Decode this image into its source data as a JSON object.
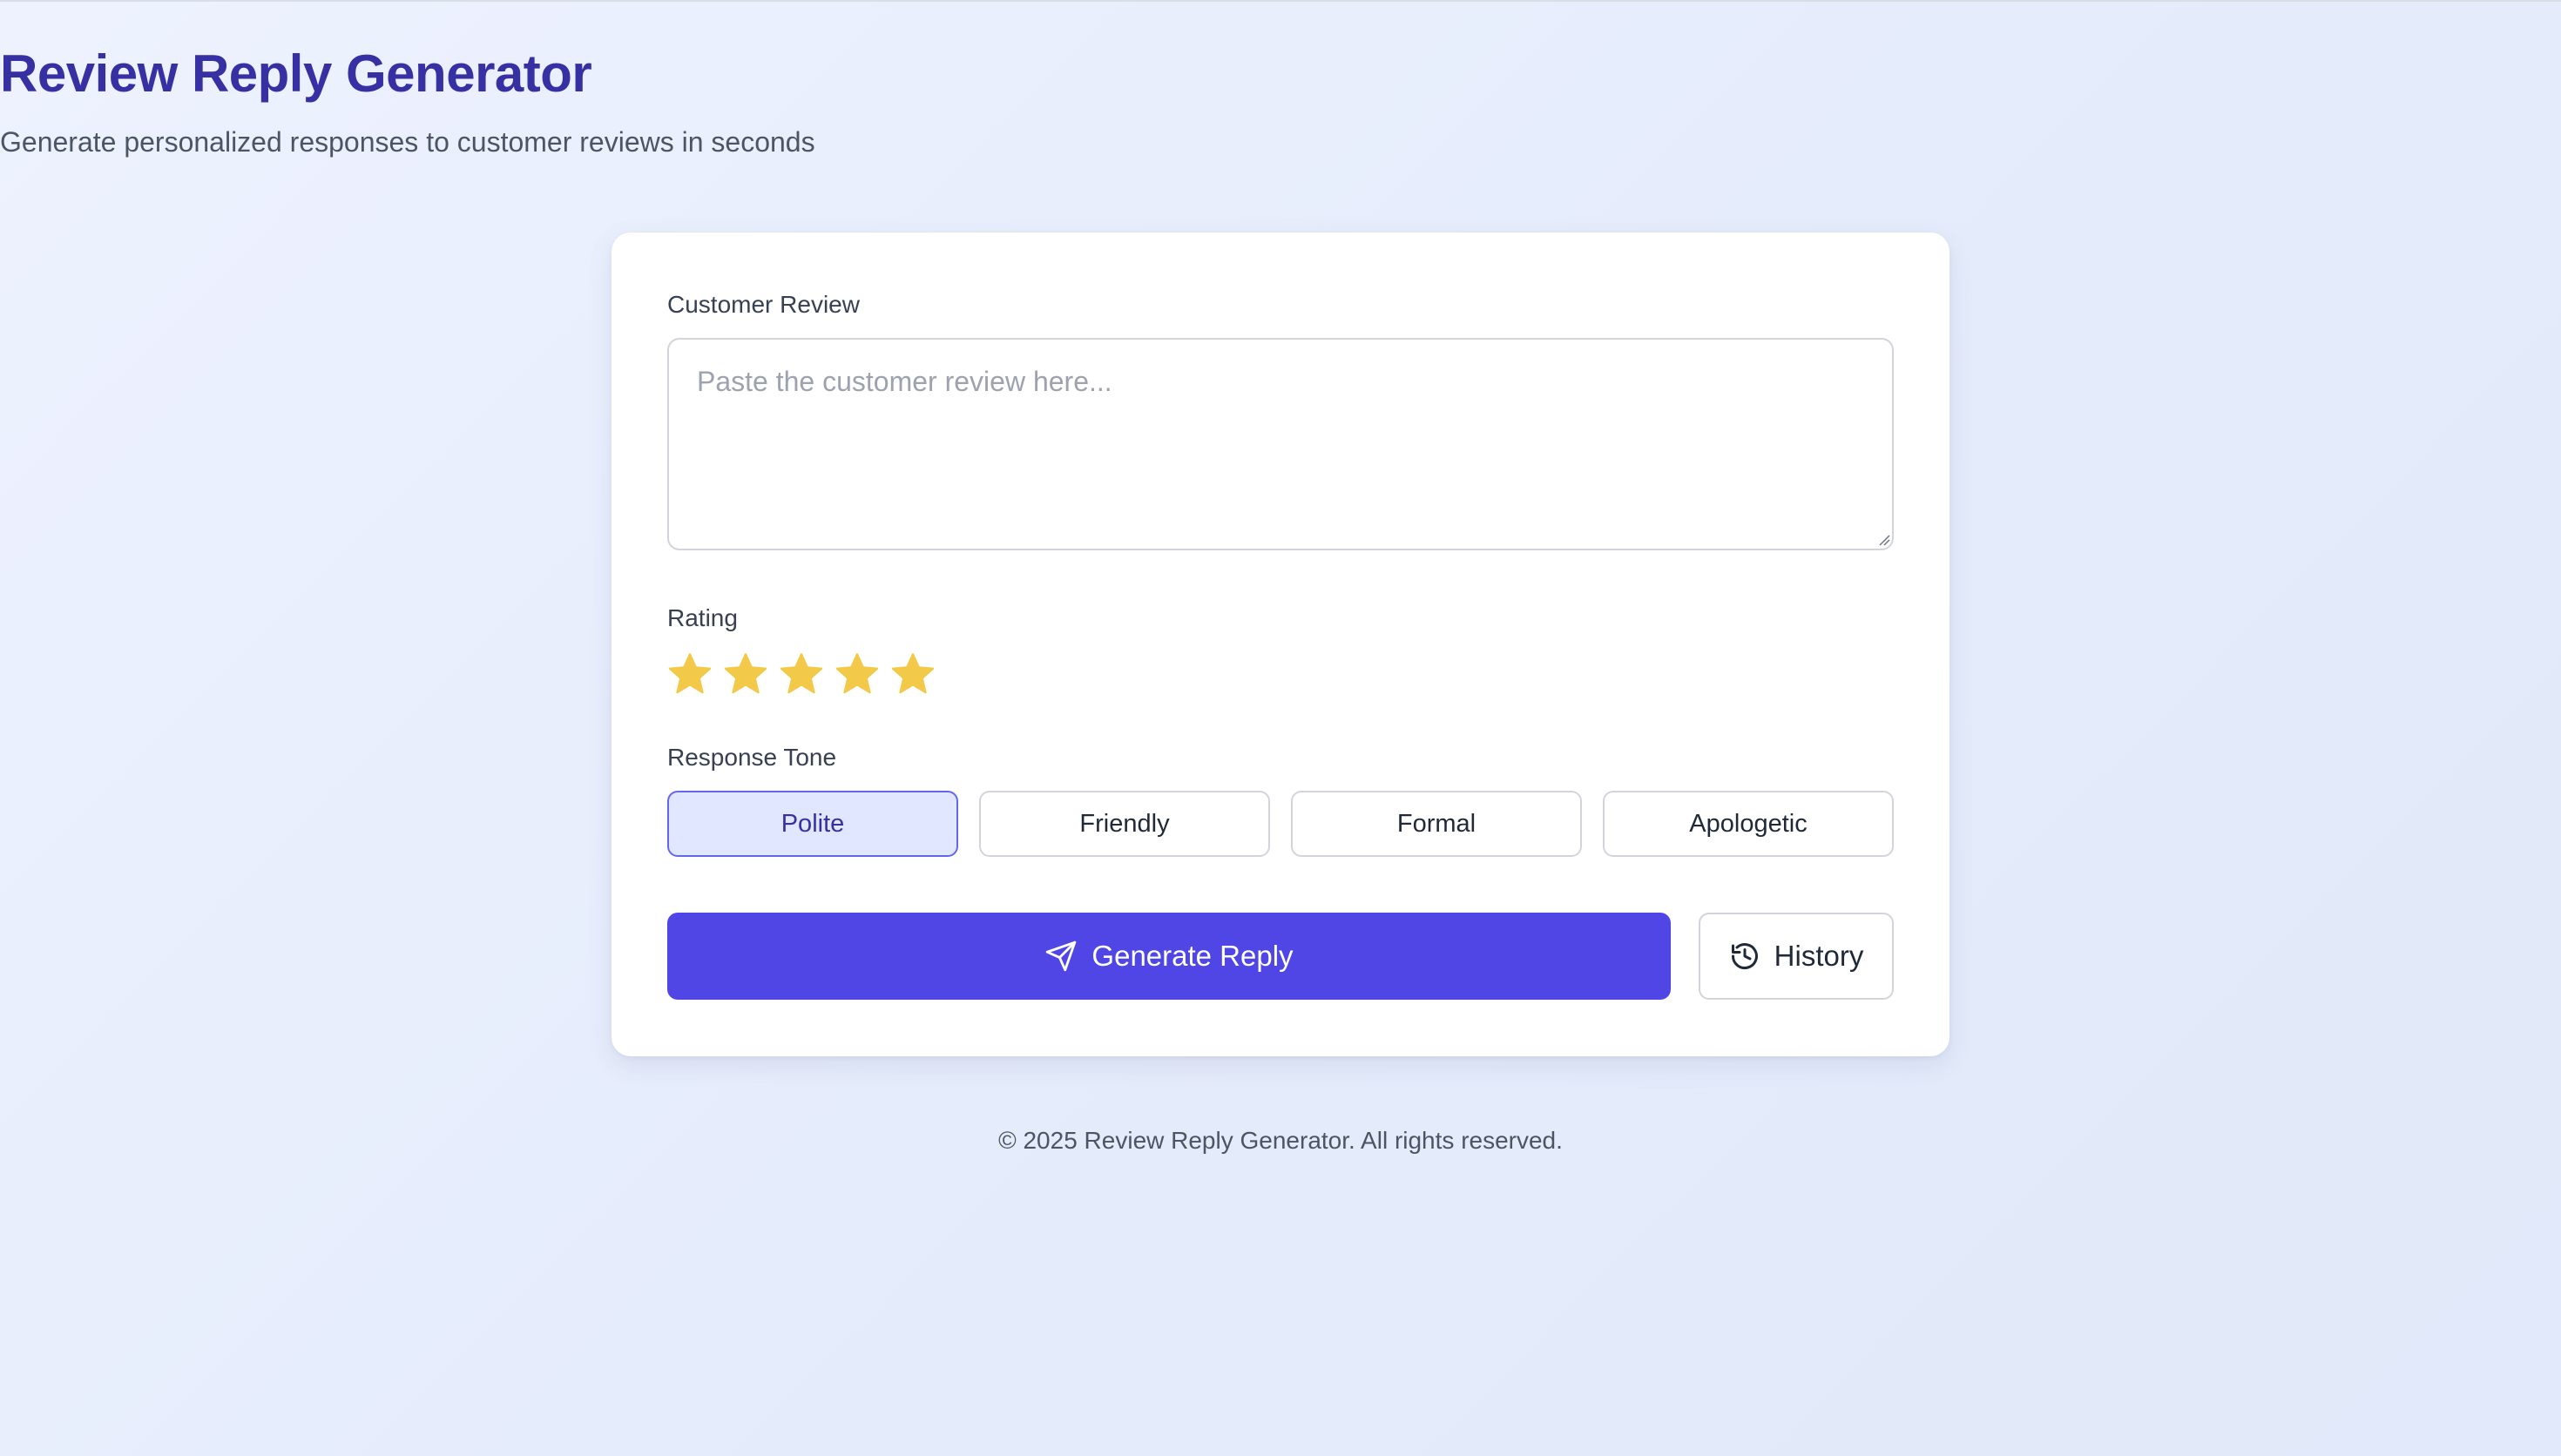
{
  "header": {
    "title": "Review Reply Generator",
    "subtitle": "Generate personalized responses to customer reviews in seconds"
  },
  "form": {
    "review": {
      "label": "Customer Review",
      "value": "",
      "placeholder": "Paste the customer review here..."
    },
    "rating": {
      "label": "Rating",
      "value": 5,
      "max": 5,
      "star_color": "#f3c94a",
      "icon": "star-icon"
    },
    "tone": {
      "label": "Response Tone",
      "options": [
        "Polite",
        "Friendly",
        "Formal",
        "Apologetic"
      ],
      "selected": "Polite"
    },
    "generate_button": {
      "label": "Generate Reply",
      "icon": "send-icon"
    },
    "history_button": {
      "label": "History",
      "icon": "history-icon"
    }
  },
  "footer": {
    "text": "© 2025 Review Reply Generator. All rights reserved."
  },
  "colors": {
    "accent": "#4f46e5",
    "title": "#3730a3",
    "selected_tone_bg": "#e0e7ff"
  }
}
